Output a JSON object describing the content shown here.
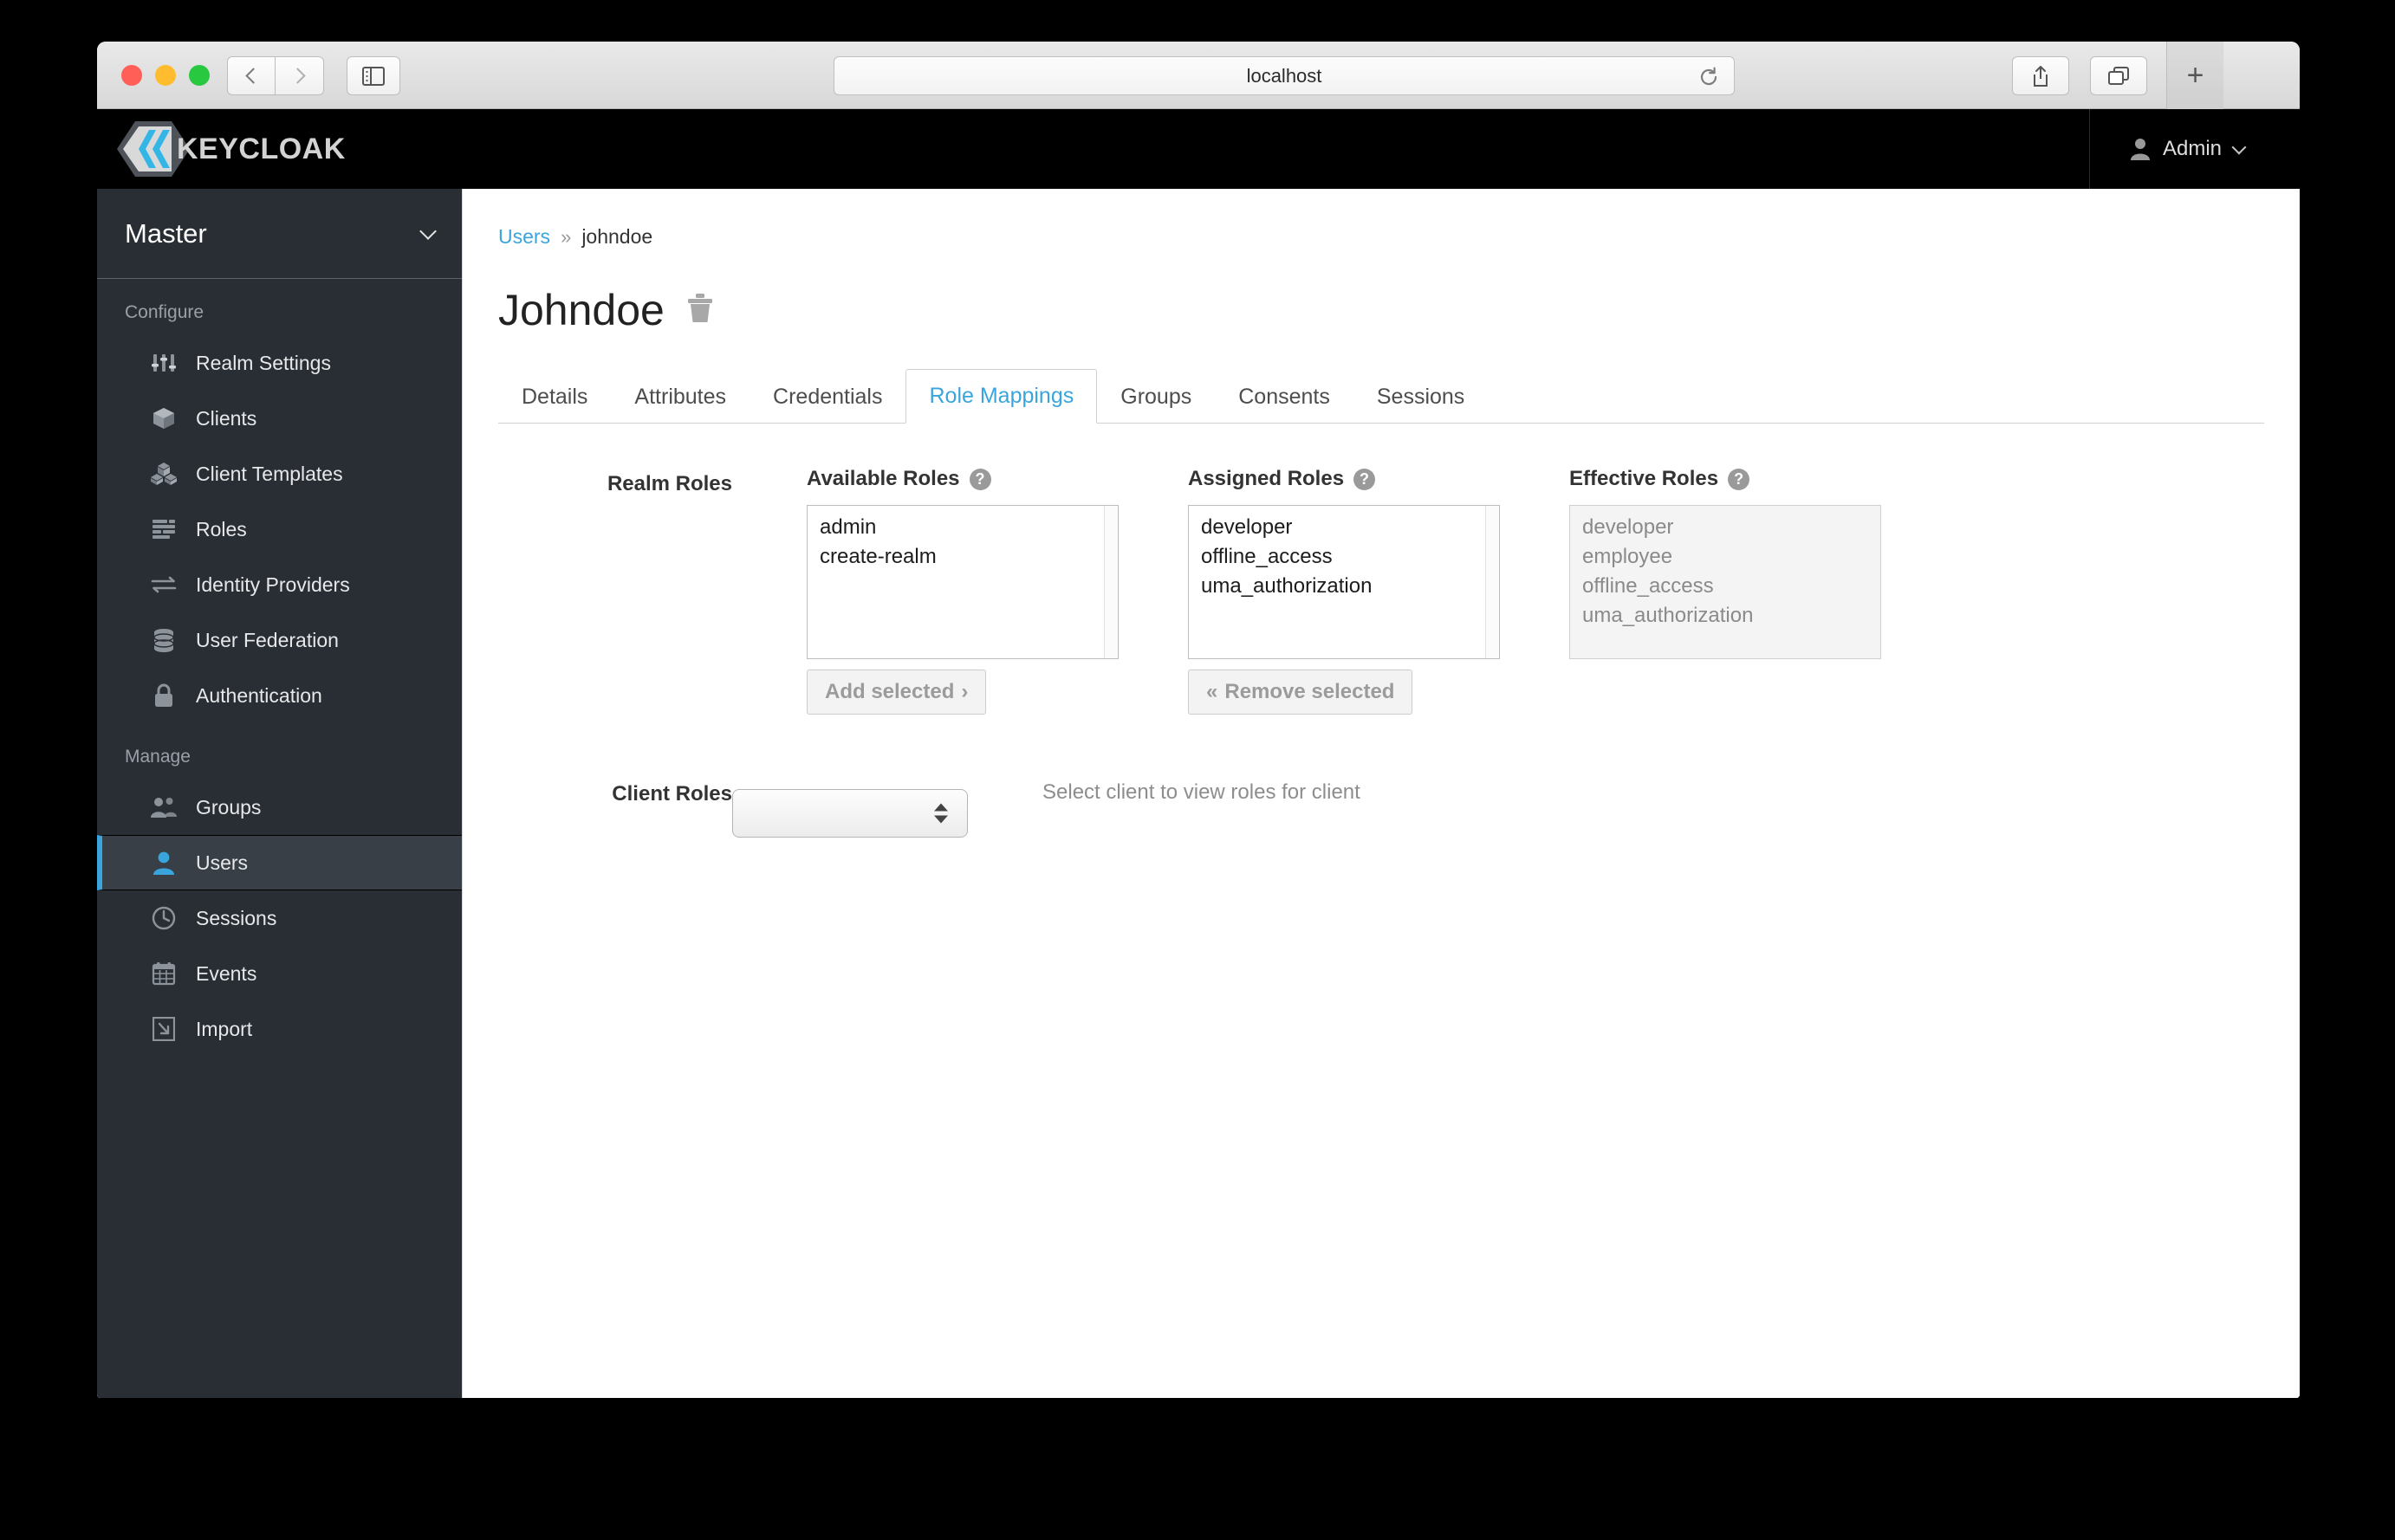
{
  "browser": {
    "address_value": "localhost",
    "back_icon": "chevron-left-icon",
    "forward_icon": "chevron-right-icon",
    "sidebar_icon": "sidebar-toggle-icon",
    "reload_icon": "reload-icon",
    "share_icon": "share-icon",
    "tabs_icon": "tabs-overview-icon",
    "newtab_label": "+"
  },
  "header": {
    "brand": "KEYCLOAK",
    "user_label": "Admin",
    "user_icon": "user-avatar-icon",
    "caret_icon": "chevron-down-icon"
  },
  "sidebar": {
    "realm": "Master",
    "realm_caret_icon": "chevron-down-icon",
    "groups": [
      {
        "label": "Configure",
        "items": [
          {
            "label": "Realm Settings",
            "icon": "sliders-icon",
            "active": false
          },
          {
            "label": "Clients",
            "icon": "cube-icon",
            "active": false
          },
          {
            "label": "Client Templates",
            "icon": "cubes-icon",
            "active": false
          },
          {
            "label": "Roles",
            "icon": "list-rows-icon",
            "active": false
          },
          {
            "label": "Identity Providers",
            "icon": "exchange-arrows-icon",
            "active": false
          },
          {
            "label": "User Federation",
            "icon": "database-icon",
            "active": false
          },
          {
            "label": "Authentication",
            "icon": "lock-icon",
            "active": false
          }
        ]
      },
      {
        "label": "Manage",
        "items": [
          {
            "label": "Groups",
            "icon": "users-group-icon",
            "active": false
          },
          {
            "label": "Users",
            "icon": "user-icon",
            "active": true
          },
          {
            "label": "Sessions",
            "icon": "clock-icon",
            "active": false
          },
          {
            "label": "Events",
            "icon": "calendar-icon",
            "active": false
          },
          {
            "label": "Import",
            "icon": "import-arrow-icon",
            "active": false
          }
        ]
      }
    ]
  },
  "main": {
    "breadcrumb": {
      "root": "Users",
      "separator": "»",
      "current": "johndoe"
    },
    "page_title": "Johndoe",
    "delete_icon": "trash-icon",
    "tabs": [
      {
        "label": "Details",
        "active": false
      },
      {
        "label": "Attributes",
        "active": false
      },
      {
        "label": "Credentials",
        "active": false
      },
      {
        "label": "Role Mappings",
        "active": true
      },
      {
        "label": "Groups",
        "active": false
      },
      {
        "label": "Consents",
        "active": false
      },
      {
        "label": "Sessions",
        "active": false
      }
    ],
    "realm_roles": {
      "label": "Realm Roles",
      "available": {
        "title": "Available Roles",
        "help_icon": "help-circle-icon",
        "items": [
          "admin",
          "create-realm"
        ],
        "button": "Add selected",
        "button_arrow": "›"
      },
      "assigned": {
        "title": "Assigned Roles",
        "help_icon": "help-circle-icon",
        "items": [
          "developer",
          "offline_access",
          "uma_authorization"
        ],
        "button": "Remove selected",
        "button_arrow": "«"
      },
      "effective": {
        "title": "Effective Roles",
        "help_icon": "help-circle-icon",
        "items": [
          "developer",
          "employee",
          "offline_access",
          "uma_authorization"
        ]
      }
    },
    "client_roles": {
      "label": "Client Roles",
      "select_value": "",
      "hint": "Select client to view roles for client"
    }
  },
  "colors": {
    "accent_blue": "#39a5dc",
    "sidebar_bg": "#292d34",
    "sidebar_active_bg": "#393f47",
    "header_bg": "#000000"
  }
}
